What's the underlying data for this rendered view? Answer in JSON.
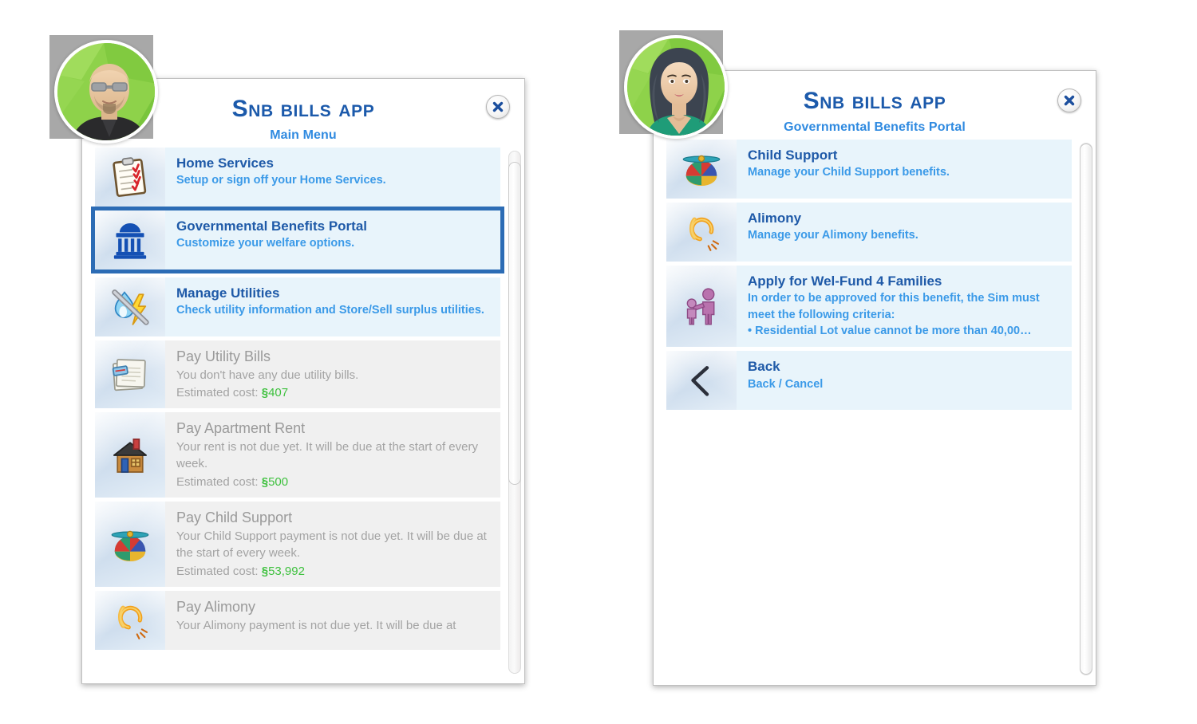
{
  "app": {
    "title": "SNB Bills App",
    "close_icon": "close-x-icon"
  },
  "panels": [
    {
      "id": "main-menu",
      "subtitle": "Main Menu",
      "avatar": {
        "name": "sim-portrait-male",
        "alt": "Male Sim portrait with glasses and black shirt on green background"
      },
      "scrollbar": {
        "thumb_top_pct": 2,
        "thumb_height_pct": 62
      },
      "items": [
        {
          "icon": "clipboard-checklist-icon",
          "title": "Home Services",
          "desc": "Setup or sign off your Home Services.",
          "state": "enabled",
          "selected": false
        },
        {
          "icon": "government-building-icon",
          "title": "Governmental Benefits Portal",
          "desc": "Customize your welfare options.",
          "state": "enabled",
          "selected": true
        },
        {
          "icon": "water-drop-lightning-icon",
          "title": "Manage Utilities",
          "desc": "Check utility information and Store/Sell surplus utilities.",
          "state": "enabled",
          "selected": false
        },
        {
          "icon": "paper-bills-icon",
          "title": "Pay Utility Bills",
          "desc": "You don't have any due utility bills.",
          "cost_label": "Estimated cost:",
          "currency": "§",
          "cost_value": "407",
          "state": "disabled",
          "selected": false
        },
        {
          "icon": "house-icon",
          "title": "Pay Apartment Rent",
          "desc": "Your rent is not due yet. It will be due at the start of every week.",
          "cost_label": "Estimated cost:",
          "currency": "§",
          "cost_value": "500",
          "state": "disabled",
          "selected": false
        },
        {
          "icon": "propeller-beanie-icon",
          "title": "Pay Child Support",
          "desc": "Your Child Support payment is not due yet. It will be due at the start of every week.",
          "cost_label": "Estimated cost:",
          "currency": "§",
          "cost_value": "53,992",
          "state": "disabled",
          "selected": false
        },
        {
          "icon": "broken-ring-icon",
          "title": "Pay Alimony",
          "desc": "Your Alimony payment is not due yet. It will be due at",
          "state": "disabled",
          "selected": false
        }
      ]
    },
    {
      "id": "benefits-portal",
      "subtitle": "Governmental Benefits Portal",
      "avatar": {
        "name": "sim-portrait-female",
        "alt": "Female Sim portrait with long dark hair and green top on green background"
      },
      "scrollbar": {
        "thumb_top_pct": 0,
        "thumb_height_pct": 100
      },
      "items": [
        {
          "icon": "propeller-beanie-icon",
          "title": "Child Support",
          "desc": "Manage your Child Support benefits.",
          "state": "enabled",
          "selected": false
        },
        {
          "icon": "broken-ring-icon",
          "title": "Alimony",
          "desc": "Manage your Alimony benefits.",
          "state": "enabled",
          "selected": false
        },
        {
          "icon": "family-parent-child-icon",
          "title": "Apply for Wel-Fund 4 Families",
          "desc": "In order to be approved for this benefit, the Sim must meet the following criteria:\n • Residential Lot value cannot be more than 40,00…",
          "state": "enabled",
          "selected": false
        },
        {
          "icon": "back-chevron-icon",
          "title": "Back",
          "desc": "Back / Cancel",
          "state": "enabled",
          "selected": false
        }
      ]
    }
  ],
  "colors": {
    "title_blue": "#1c5aab",
    "subtitle_blue": "#2f8ae0",
    "row_title_blue": "#1f5aa8",
    "row_desc_blue": "#3b9ae8",
    "row_bg_enabled": "#e8f4fb",
    "row_bg_disabled": "#f0f0f0",
    "disabled_text": "#9a9a9a",
    "simoleon_green": "#3fc13f",
    "selection_border": "#2c6cb5"
  }
}
